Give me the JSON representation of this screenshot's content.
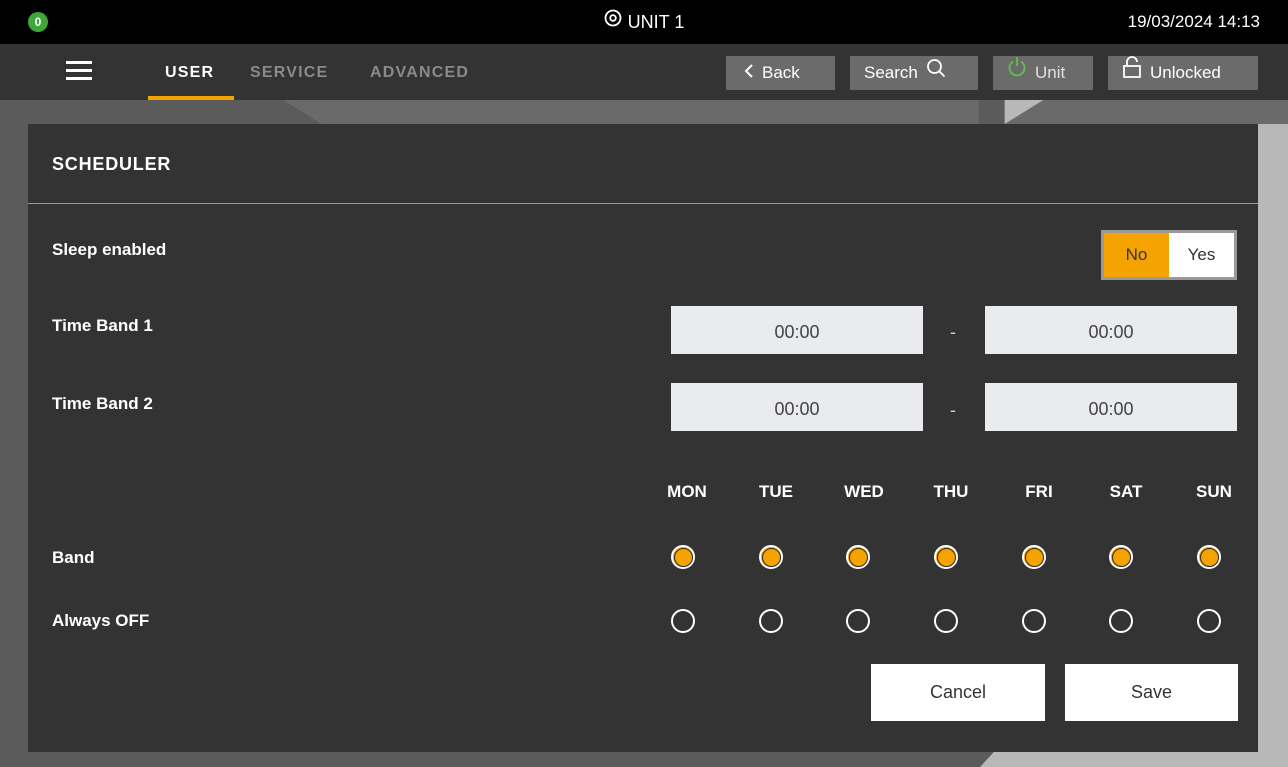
{
  "status_bar": {
    "alarm_count": "0",
    "unit_name": "UNIT 1",
    "datetime": "19/03/2024 14:13"
  },
  "nav": {
    "tabs": [
      {
        "label": "USER",
        "active": true
      },
      {
        "label": "SERVICE",
        "active": false
      },
      {
        "label": "ADVANCED",
        "active": false
      }
    ],
    "back_label": "Back",
    "search_label": "Search",
    "unit_label": "Unit",
    "lock_label": "Unlocked"
  },
  "scheduler": {
    "title": "SCHEDULER",
    "sleep_enabled": {
      "label": "Sleep enabled",
      "options": [
        "No",
        "Yes"
      ],
      "selected": "No"
    },
    "time_band_1": {
      "label": "Time Band 1",
      "start": "00:00",
      "separator": "-",
      "end": "00:00"
    },
    "time_band_2": {
      "label": "Time Band 2",
      "start": "00:00",
      "separator": "-",
      "end": "00:00"
    },
    "days": [
      "MON",
      "TUE",
      "WED",
      "THU",
      "FRI",
      "SAT",
      "SUN"
    ],
    "rows": [
      {
        "label": "Band",
        "selection": [
          true,
          true,
          true,
          true,
          true,
          true,
          true
        ]
      },
      {
        "label": "Always OFF",
        "selection": [
          false,
          false,
          false,
          false,
          false,
          false,
          false
        ]
      }
    ],
    "cancel_label": "Cancel",
    "save_label": "Save"
  },
  "colors": {
    "accent": "#f5a300",
    "alarm_badge": "#3fa73a",
    "panel_bg": "#333333",
    "unit_power_icon": "#5cc24a"
  }
}
